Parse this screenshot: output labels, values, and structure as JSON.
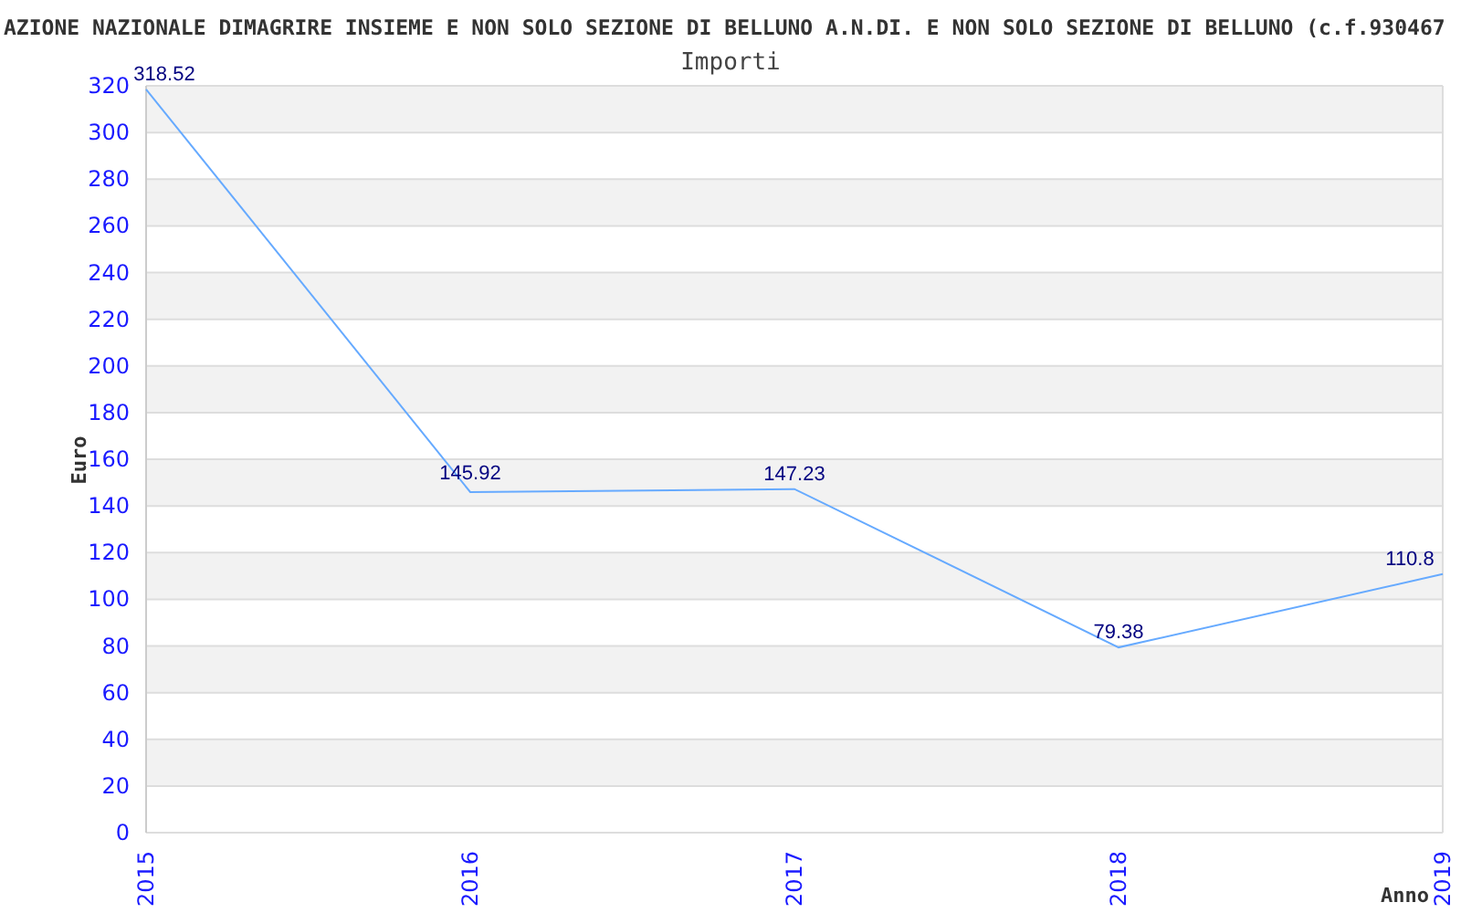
{
  "page_title": "AZIONE NAZIONALE DIMAGRIRE INSIEME E NON SOLO SEZIONE DI BELLUNO A.N.DI. E NON SOLO SEZIONE DI BELLUNO (c.f.930467",
  "chart": {
    "chart_data": {
      "type": "line",
      "title": "Importi",
      "xlabel": "Anno",
      "ylabel": "Euro",
      "categories": [
        "2015",
        "2016",
        "2017",
        "2018",
        "2019"
      ],
      "series": [
        {
          "color": "#66aaff",
          "values": [
            318.52,
            145.92,
            147.23,
            79.38,
            110.8
          ]
        }
      ],
      "ylim": [
        0,
        320
      ],
      "yticks": [
        0,
        20,
        40,
        60,
        80,
        100,
        120,
        140,
        160,
        180,
        200,
        220,
        240,
        260,
        280,
        300,
        320
      ],
      "data_labels": true,
      "grid": true
    }
  }
}
